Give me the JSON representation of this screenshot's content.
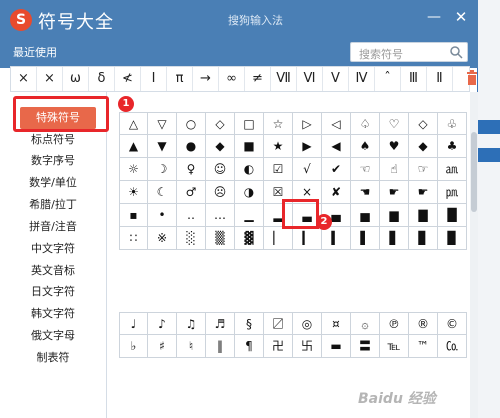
{
  "title_bar": {
    "logo_glyph": "S",
    "app_title": "符号大全",
    "center_title": "搜狗输入法",
    "minimize_glyph": "—",
    "close_glyph": "✕"
  },
  "recent": {
    "label": "最近使用",
    "symbols": [
      "×",
      "×",
      "ω",
      "δ",
      "≮",
      "Ⅰ",
      "π",
      "→",
      "∞",
      "≠",
      "Ⅶ",
      "Ⅵ",
      "Ⅴ",
      "Ⅳ",
      "ˆ",
      "Ⅲ",
      "Ⅱ"
    ]
  },
  "search": {
    "placeholder": "搜索符号"
  },
  "nav": {
    "items": [
      "特殊符号",
      "标点符号",
      "数字序号",
      "数学/单位",
      "希腊/拉丁",
      "拼音/注音",
      "中文字符",
      "英文音标",
      "日文字符",
      "韩文字符",
      "俄文字母",
      "制表符"
    ],
    "active_index": 0
  },
  "annotations": {
    "badge1": "1",
    "badge2": "2"
  },
  "grid1": [
    [
      "△",
      "▽",
      "○",
      "◇",
      "□",
      "☆",
      "▷",
      "◁",
      "♤",
      "♡",
      "◇",
      "♧"
    ],
    [
      "▲",
      "▼",
      "●",
      "◆",
      "■",
      "★",
      "▶",
      "◀",
      "♠",
      "♥",
      "◆",
      "♣"
    ],
    [
      "☼",
      "☽",
      "♀",
      "☺",
      "◐",
      "☑",
      "√",
      "✔",
      "☜",
      "☝",
      "☞",
      "㏂"
    ],
    [
      "☀",
      "☾",
      "♂",
      "☹",
      "◑",
      "☒",
      "×",
      "✘",
      "☚",
      "☛",
      "☛",
      "㏘"
    ],
    [
      "▪",
      "•",
      "‥",
      "…",
      "▁",
      "▂",
      "▃",
      "▄",
      "▅",
      "▆",
      "▇",
      "█"
    ],
    [
      "∷",
      "※",
      "░",
      "▒",
      "▓",
      "▏",
      "▎",
      "▍",
      "▌",
      "▋",
      "▊",
      "▉"
    ]
  ],
  "grid2": [
    [
      "♩",
      "♪",
      "♫",
      "♬",
      "§",
      "〼",
      "◎",
      "¤",
      "۞",
      "℗",
      "®",
      "©"
    ],
    [
      "♭",
      "♯",
      "♮",
      "‖",
      "¶",
      "卍",
      "卐",
      "▬",
      "〓",
      "℡",
      "™",
      "㏇"
    ]
  ],
  "watermark": "Baidu 经验",
  "colors": {
    "title_bar": "#4a7fb5",
    "active_nav": "#e8684a",
    "highlight": "#e8262a"
  }
}
